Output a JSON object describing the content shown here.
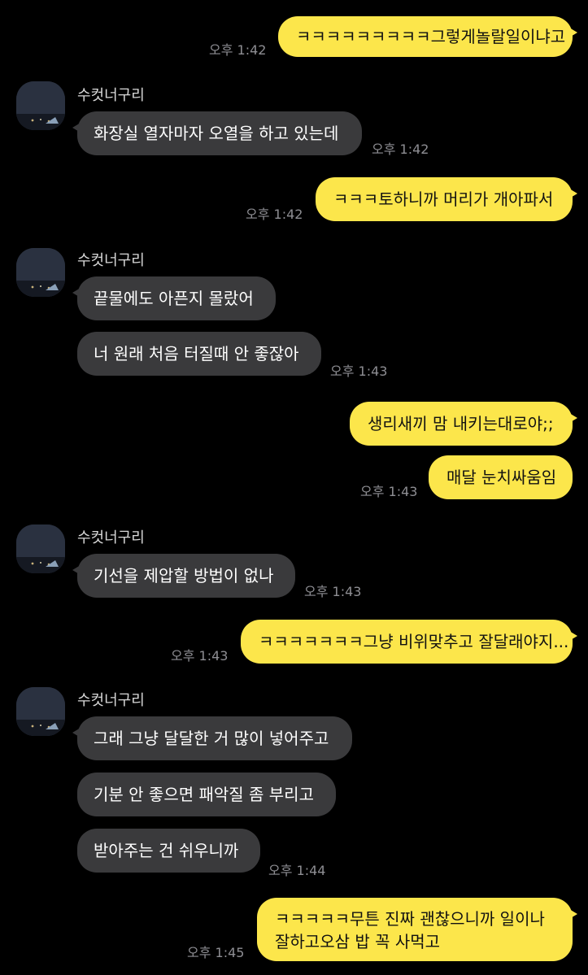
{
  "colors": {
    "background": "#000000",
    "my_bubble": "#fce64b",
    "their_bubble": "#3a3a3c",
    "timestamp": "#8e8e93"
  },
  "sender_name": "수컷너구리",
  "messages": [
    {
      "text": "ㅋㅋㅋㅋㅋㅋㅋㅋㅋ그렇게놀랄일이냐고",
      "time": "오후 1:42"
    },
    {
      "text": "화장실 열자마자 오열을 하고 있는데",
      "time": "오후 1:42"
    },
    {
      "text": "ㅋㅋㅋ토하니까 머리가 개아파서",
      "time": "오후 1:42"
    },
    {
      "text": "끝물에도 아픈지 몰랐어"
    },
    {
      "text": "너 원래 처음 터질때 안 좋잖아",
      "time": "오후 1:43"
    },
    {
      "text": "생리새끼 맘 내키는대로야;;"
    },
    {
      "text": "매달 눈치싸움임",
      "time": "오후 1:43"
    },
    {
      "text": "기선을 제압할 방법이 없나",
      "time": "오후 1:43"
    },
    {
      "text": "ㅋㅋㅋㅋㅋㅋㅋ그냥 비위맞추고 잘달래야지...",
      "time": "오후 1:43"
    },
    {
      "text": "그래 그냥 달달한 거 많이 넣어주고"
    },
    {
      "text": "기분 안 좋으면 패악질 좀 부리고"
    },
    {
      "text": "받아주는 건 쉬우니까",
      "time": "오후 1:44"
    },
    {
      "text_line1": "ㅋㅋㅋㅋㅋ무튼 진짜 괜찮으니까 일이나",
      "text_line2": "잘하고오삼 밥 꼭 사먹고",
      "time": "오후 1:45"
    }
  ]
}
